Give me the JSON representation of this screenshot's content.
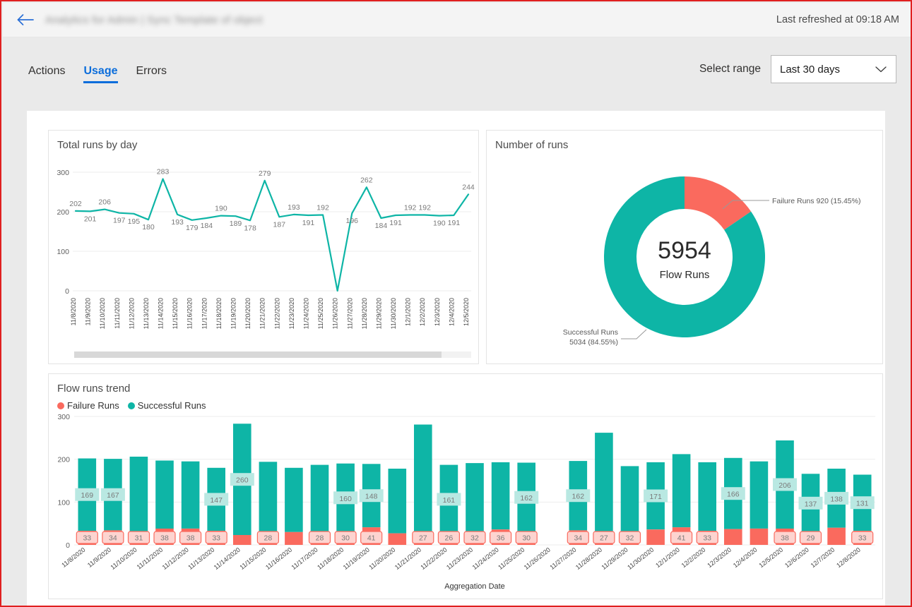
{
  "header": {
    "back_icon": "arrow-left-icon",
    "document_title": "Analytics for Admin | Sync Template of object",
    "last_refreshed": "Last refreshed at 09:18 AM"
  },
  "tabs": [
    {
      "label": "Actions",
      "active": false
    },
    {
      "label": "Usage",
      "active": true
    },
    {
      "label": "Errors",
      "active": false
    }
  ],
  "range": {
    "label": "Select range",
    "value": "Last 30 days",
    "chevron_icon": "chevron-down-icon",
    "options": [
      "Last 30 days"
    ]
  },
  "colors": {
    "teal": "#0eb5a6",
    "teal_label_bg": "#b9e8e2",
    "red": "#fa6a5e",
    "red_label_bg": "#fdd4d0",
    "accent_blue": "#0b6ddb",
    "grid": "#ededed",
    "page_bg": "#eaeaea"
  },
  "chart_data": [
    {
      "type": "line",
      "title": "Total runs by day",
      "xlabel": "",
      "ylabel": "",
      "ylim": [
        0,
        300
      ],
      "yticks": [
        0,
        100,
        200,
        300
      ],
      "grid": true,
      "legend": "none",
      "series_color": "#0eb5a6",
      "categories": [
        "11/8/2020",
        "11/9/2020",
        "11/10/2020",
        "11/11/2020",
        "11/12/2020",
        "11/13/2020",
        "11/14/2020",
        "11/15/2020",
        "11/16/2020",
        "11/17/2020",
        "11/18/2020",
        "11/19/2020",
        "11/20/2020",
        "11/21/2020",
        "11/22/2020",
        "11/23/2020",
        "11/24/2020",
        "11/25/2020",
        "11/26/2020",
        "11/27/2020",
        "11/28/2020",
        "11/29/2020",
        "11/30/2020",
        "12/1/2020",
        "12/2/2020",
        "12/3/2020",
        "12/4/2020",
        "12/5/2020"
      ],
      "values": [
        202,
        201,
        206,
        197,
        195,
        180,
        283,
        193,
        179,
        184,
        190,
        189,
        178,
        279,
        187,
        193,
        191,
        192,
        0,
        196,
        262,
        184,
        191,
        192,
        192,
        190,
        191,
        244
      ],
      "point_labels": [
        "202",
        "201",
        "206",
        "197",
        "195",
        "180",
        "283",
        "193",
        "179",
        "184",
        "190",
        "189",
        "178",
        "279",
        "187",
        "193",
        "191",
        "192",
        "",
        "196",
        "262",
        "184",
        "191",
        "192",
        "192",
        "190",
        "191",
        "244"
      ]
    },
    {
      "type": "pie",
      "title": "Number of runs",
      "donut": true,
      "center_value": "5954",
      "center_label": "Flow Runs",
      "slices": [
        {
          "name": "Failure Runs",
          "value": 920,
          "percent": "15.45%",
          "color": "#fa6a5e",
          "callout": "Failure Runs 920 (15.45%)"
        },
        {
          "name": "Successful Runs",
          "value": 5034,
          "percent": "84.55%",
          "color": "#0eb5a6",
          "callout_line1": "Successful Runs",
          "callout_line2": "5034 (84.55%)"
        }
      ]
    },
    {
      "type": "bar",
      "stacked": true,
      "title": "Flow runs trend",
      "xlabel": "Aggregation Date",
      "ylabel": "",
      "ylim": [
        0,
        300
      ],
      "yticks": [
        0,
        100,
        200,
        300
      ],
      "grid": true,
      "legend_position": "top-left",
      "legend": [
        "Failure Runs",
        "Successful Runs"
      ],
      "categories": [
        "11/8/2020",
        "11/9/2020",
        "11/10/2020",
        "11/11/2020",
        "11/12/2020",
        "11/13/2020",
        "11/14/2020",
        "11/15/2020",
        "11/16/2020",
        "11/17/2020",
        "11/18/2020",
        "11/19/2020",
        "11/20/2020",
        "11/21/2020",
        "11/22/2020",
        "11/23/2020",
        "11/24/2020",
        "11/25/2020",
        "11/26/2020",
        "11/27/2020",
        "11/28/2020",
        "11/29/2020",
        "11/30/2020",
        "12/1/2020",
        "12/2/2020",
        "12/3/2020",
        "12/4/2020",
        "12/5/2020",
        "12/6/2020",
        "12/7/2020",
        "12/8/2020"
      ],
      "series": [
        {
          "name": "Failure Runs",
          "color": "#fa6a5e",
          "values": [
            33,
            34,
            31,
            38,
            38,
            33,
            23,
            28,
            30,
            28,
            30,
            41,
            27,
            27,
            26,
            32,
            36,
            30,
            0,
            34,
            27,
            32,
            36,
            41,
            33,
            37,
            38,
            38,
            29,
            40,
            33
          ],
          "labels": [
            "33",
            "34",
            "31",
            "38",
            "38",
            "33",
            "",
            "28",
            "",
            "28",
            "30",
            "41",
            "",
            "27",
            "26",
            "32",
            "36",
            "30",
            "",
            "34",
            "27",
            "32",
            "",
            "41",
            "33",
            "",
            "",
            "38",
            "29",
            "",
            "33"
          ]
        },
        {
          "name": "Successful Runs",
          "color": "#0eb5a6",
          "values": [
            169,
            167,
            175,
            159,
            157,
            147,
            260,
            166,
            150,
            159,
            160,
            148,
            151,
            254,
            161,
            159,
            157,
            162,
            0,
            162,
            235,
            152,
            157,
            171,
            160,
            166,
            157,
            206,
            137,
            138,
            131
          ],
          "labels": [
            "169",
            "167",
            "",
            "",
            "",
            "147",
            "260",
            "",
            "",
            "",
            "160",
            "148",
            "",
            "",
            "161",
            "",
            "",
            "162",
            "",
            "162",
            "",
            "",
            "171",
            "",
            "",
            "166",
            "",
            "206",
            "137",
            "138",
            "131"
          ]
        }
      ]
    }
  ]
}
